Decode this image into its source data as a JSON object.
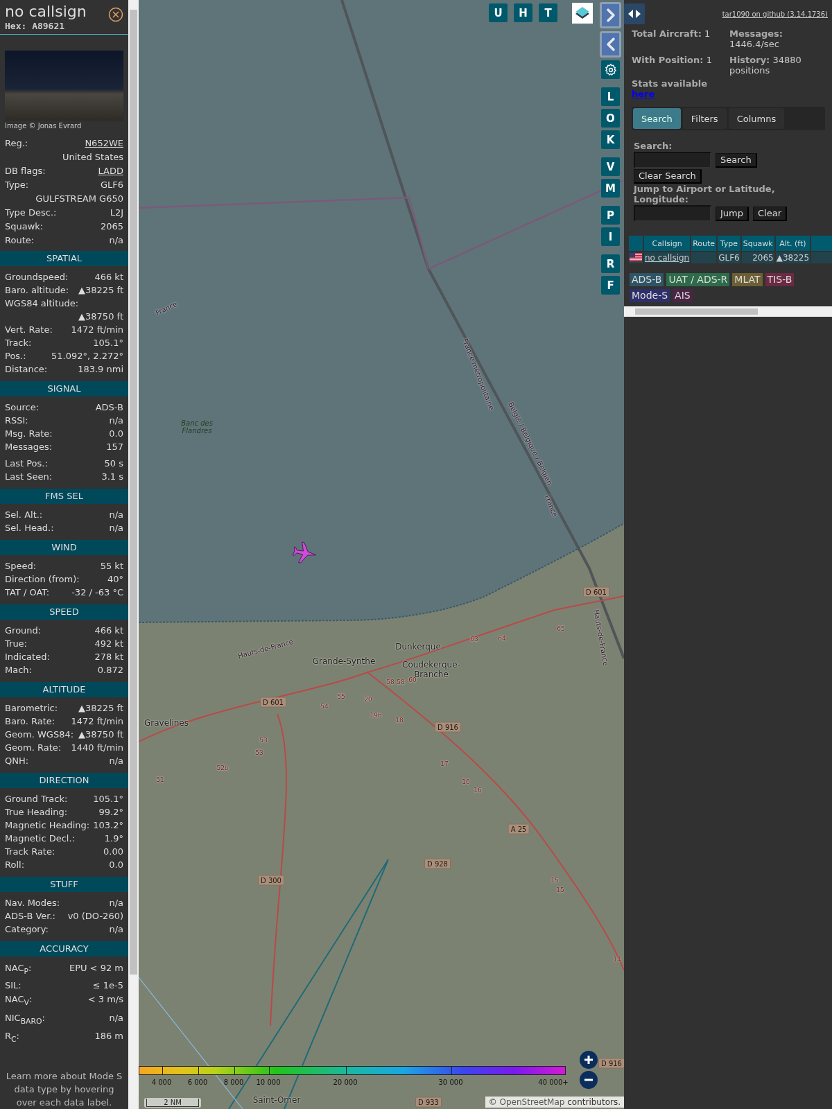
{
  "sidebar": {
    "callsign": "no callsign",
    "hex": "Hex: A89621",
    "photo_credit": "Image © Jonas Evrard",
    "details": [
      {
        "kind": "link",
        "label": "Reg.:",
        "value": "N652WE"
      },
      {
        "kind": "continuation",
        "value": "United States"
      },
      {
        "kind": "link",
        "label": "DB flags:",
        "value": "LADD"
      },
      {
        "kind": "pair",
        "label": "Type:",
        "value": "GLF6"
      },
      {
        "kind": "continuation",
        "value": "GULFSTREAM G650"
      },
      {
        "kind": "pair",
        "label": "Type Desc.:",
        "value": "L2J"
      },
      {
        "kind": "pair",
        "label": "Squawk:",
        "value": "2065"
      },
      {
        "kind": "pair",
        "label": "Route:",
        "value": "n/a"
      }
    ],
    "sections": [
      {
        "title": "SPATIAL",
        "rows": [
          {
            "kind": "pair",
            "label": "Groundspeed:",
            "value": "466 kt"
          },
          {
            "kind": "pair",
            "label": "Baro. altitude:",
            "value": "▲38225 ft"
          },
          {
            "kind": "stacked",
            "label": "WGS84 altitude:",
            "value": "▲38750 ft"
          },
          {
            "kind": "pair",
            "label": "Vert. Rate:",
            "value": "1472 ft/min"
          },
          {
            "kind": "pair",
            "label": "Track:",
            "value": "105.1°"
          },
          {
            "kind": "pair",
            "label": "Pos.:",
            "value": "51.092°, 2.272°"
          },
          {
            "kind": "pair",
            "label": "Distance:",
            "value": "183.9 nmi"
          }
        ]
      },
      {
        "title": "SIGNAL",
        "rows": [
          {
            "kind": "pair",
            "label": "Source:",
            "value": "ADS-B"
          },
          {
            "kind": "pair",
            "label": "RSSI:",
            "value": "n/a"
          },
          {
            "kind": "pair",
            "label": "Msg. Rate:",
            "value": "0.0"
          },
          {
            "kind": "pair",
            "label": "Messages:",
            "value": "157"
          },
          {
            "kind": "gap",
            "label": "Last Pos.:",
            "value": "50 s"
          },
          {
            "kind": "pair",
            "label": "Last Seen:",
            "value": "3.1 s"
          }
        ]
      },
      {
        "title": "FMS SEL",
        "rows": [
          {
            "kind": "pair",
            "label": "Sel. Alt.:",
            "value": "n/a"
          },
          {
            "kind": "pair",
            "label": "Sel. Head.:",
            "value": "n/a"
          }
        ]
      },
      {
        "title": "WIND",
        "rows": [
          {
            "kind": "pair",
            "label": "Speed:",
            "value": "55 kt"
          },
          {
            "kind": "pair",
            "label": "Direction (from):",
            "value": "40°"
          },
          {
            "kind": "pair",
            "label": "TAT / OAT:",
            "value": "-32 / -63 °C"
          }
        ]
      },
      {
        "title": "SPEED",
        "rows": [
          {
            "kind": "pair",
            "label": "Ground:",
            "value": "466 kt"
          },
          {
            "kind": "pair",
            "label": "True:",
            "value": "492 kt"
          },
          {
            "kind": "pair",
            "label": "Indicated:",
            "value": "278 kt"
          },
          {
            "kind": "pair",
            "label": "Mach:",
            "value": "0.872"
          }
        ]
      },
      {
        "title": "ALTITUDE",
        "rows": [
          {
            "kind": "pair",
            "label": "Barometric:",
            "value": "▲38225 ft"
          },
          {
            "kind": "pair",
            "label": "Baro. Rate:",
            "value": "1472 ft/min"
          },
          {
            "kind": "pair",
            "label": "Geom. WGS84:",
            "value": "▲38750 ft"
          },
          {
            "kind": "pair",
            "label": "Geom. Rate:",
            "value": "1440 ft/min"
          },
          {
            "kind": "pair",
            "label": "QNH:",
            "value": "n/a"
          }
        ]
      },
      {
        "title": "DIRECTION",
        "rows": [
          {
            "kind": "pair",
            "label": "Ground Track:",
            "value": "105.1°"
          },
          {
            "kind": "pair",
            "label": "True Heading:",
            "value": "99.2°"
          },
          {
            "kind": "pair",
            "label": "Magnetic Heading:",
            "value": "103.2°"
          },
          {
            "kind": "pair",
            "label": "Magnetic Decl.:",
            "value": "1.9°"
          },
          {
            "kind": "pair",
            "label": "Track Rate:",
            "value": "0.00"
          },
          {
            "kind": "pair",
            "label": "Roll:",
            "value": "0.0"
          }
        ]
      },
      {
        "title": "STUFF",
        "rows": [
          {
            "kind": "pair",
            "label": "Nav. Modes:",
            "value": "n/a"
          },
          {
            "kind": "pair",
            "label": "ADS-B Ver.:",
            "value": "v0 (DO-260)"
          },
          {
            "kind": "pair",
            "label": "Category:",
            "value": "n/a"
          }
        ]
      },
      {
        "title": "ACCURACY",
        "rows": [
          {
            "kind": "tall",
            "label": "NAC$_{P}$:",
            "value": "EPU < 92 m"
          },
          {
            "kind": "pair",
            "label": "SIL:",
            "value": "≤ 1e-5"
          },
          {
            "kind": "tall",
            "label": "NAC$_{V}$:",
            "value": "< 3 m/s"
          },
          {
            "kind": "tall",
            "label": "NIC$_{BARO}$:",
            "value": "n/a"
          },
          {
            "kind": "tall",
            "label": "R$_{C}$:",
            "value": "186 m"
          }
        ]
      }
    ],
    "footer": "Learn more about Mode S data type by hovering over each data label."
  },
  "map": {
    "top_buttons": [
      "U",
      "H",
      "T"
    ],
    "side_buttons": [
      {
        "kind": "next"
      },
      {
        "kind": "prev"
      },
      {
        "kind": "settings"
      },
      {
        "kind": "letter",
        "label": "L"
      },
      {
        "kind": "letter",
        "label": "O"
      },
      {
        "kind": "letter",
        "label": "K"
      },
      {
        "kind": "letter",
        "label": "V"
      },
      {
        "kind": "letter",
        "label": "M"
      },
      {
        "kind": "letter",
        "label": "P"
      },
      {
        "kind": "letter",
        "label": "I"
      },
      {
        "kind": "letter",
        "label": "R"
      },
      {
        "kind": "letter",
        "label": "F"
      }
    ],
    "places": [
      "Banc des Flandres",
      "Dunkerque",
      "Grande-Synthe",
      "Coudekerque-Branche",
      "Gravelines",
      "Saint-Omer"
    ],
    "boundary_labels": [
      "France métropolitaine",
      "België / Belgique / Belgien",
      "France",
      "Hauts-de-France",
      "Hauts-de-France",
      "France"
    ],
    "road_refs": [
      "D 601",
      "D 601",
      "D 916",
      "A 25",
      "D 928",
      "D 300",
      "D 916",
      "D 933"
    ],
    "road_numbers": [
      "63",
      "64",
      "65",
      "58",
      "58",
      "60",
      "55",
      "54",
      "20",
      "19b",
      "18",
      "17",
      "16",
      "16",
      "15",
      "15",
      "14",
      "53",
      "53",
      "52b",
      "51"
    ],
    "altitude_scale": [
      "4 000",
      "6 000",
      "8 000",
      "10 000",
      "20 000",
      "30 000",
      "40 000+"
    ],
    "scale": "2 NM",
    "attribution": {
      "prefix": "©",
      "link": "OpenStreetMap",
      "suffix": "contributors."
    }
  },
  "panel": {
    "github_link": "tar1090 on github (3.14.1736)",
    "stats": [
      "**Total Aircraft:** 1",
      "**Messages:** 1446.4/sec",
      "**With Position:** 1",
      "**History:** 34880 positions"
    ],
    "stats_note": "Stats available",
    "stats_link": "here",
    "tabs": [
      {
        "label": "Search",
        "selected": true
      },
      {
        "label": "Filters",
        "selected": false
      },
      {
        "label": "Columns",
        "selected": false
      }
    ],
    "search_label": "Search:",
    "search_button": "Search",
    "clear_search_button": "Clear Search",
    "jump_label": "Jump to Airport or Latitude, Longitude:",
    "jump_button": "Jump",
    "clear_button": "Clear",
    "table": {
      "columns": [
        "Callsign",
        "Route",
        "Type",
        "Squawk",
        "Alt. (ft)"
      ],
      "rows": [
        {
          "callsign": "no callsign",
          "type": "GLF6",
          "squawk": "2065",
          "altitude": "▲38225"
        }
      ]
    },
    "legend": [
      {
        "label": "ADS-B",
        "color": "#2e5566"
      },
      {
        "label": "UAT / ADS-R",
        "color": "#2d6b4a"
      },
      {
        "label": "MLAT",
        "color": "#6b5f33"
      },
      {
        "label": "TIS-B",
        "color": "#6b2a44"
      },
      {
        "label": "Mode-S",
        "color": "#2f2f6b"
      },
      {
        "label": "AIS",
        "color": "#4a2545"
      }
    ]
  }
}
